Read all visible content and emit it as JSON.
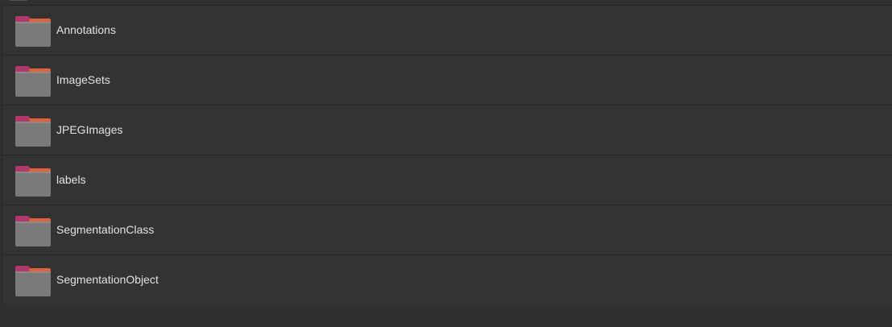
{
  "folders": [
    {
      "name": "Annotations",
      "icon": "folder-icon"
    },
    {
      "name": "ImageSets",
      "icon": "folder-icon"
    },
    {
      "name": "JPEGImages",
      "icon": "folder-icon"
    },
    {
      "name": "labels",
      "icon": "folder-icon"
    },
    {
      "name": "SegmentationClass",
      "icon": "folder-icon"
    },
    {
      "name": "SegmentationObject",
      "icon": "folder-icon"
    }
  ],
  "colors": {
    "background": "#2f2f2f",
    "row": "#333333",
    "text": "#e2e2e2",
    "folder_body": "#7a7a7a",
    "folder_tab_pink": "#b0386a",
    "folder_tab_orange": "#e2603a"
  }
}
